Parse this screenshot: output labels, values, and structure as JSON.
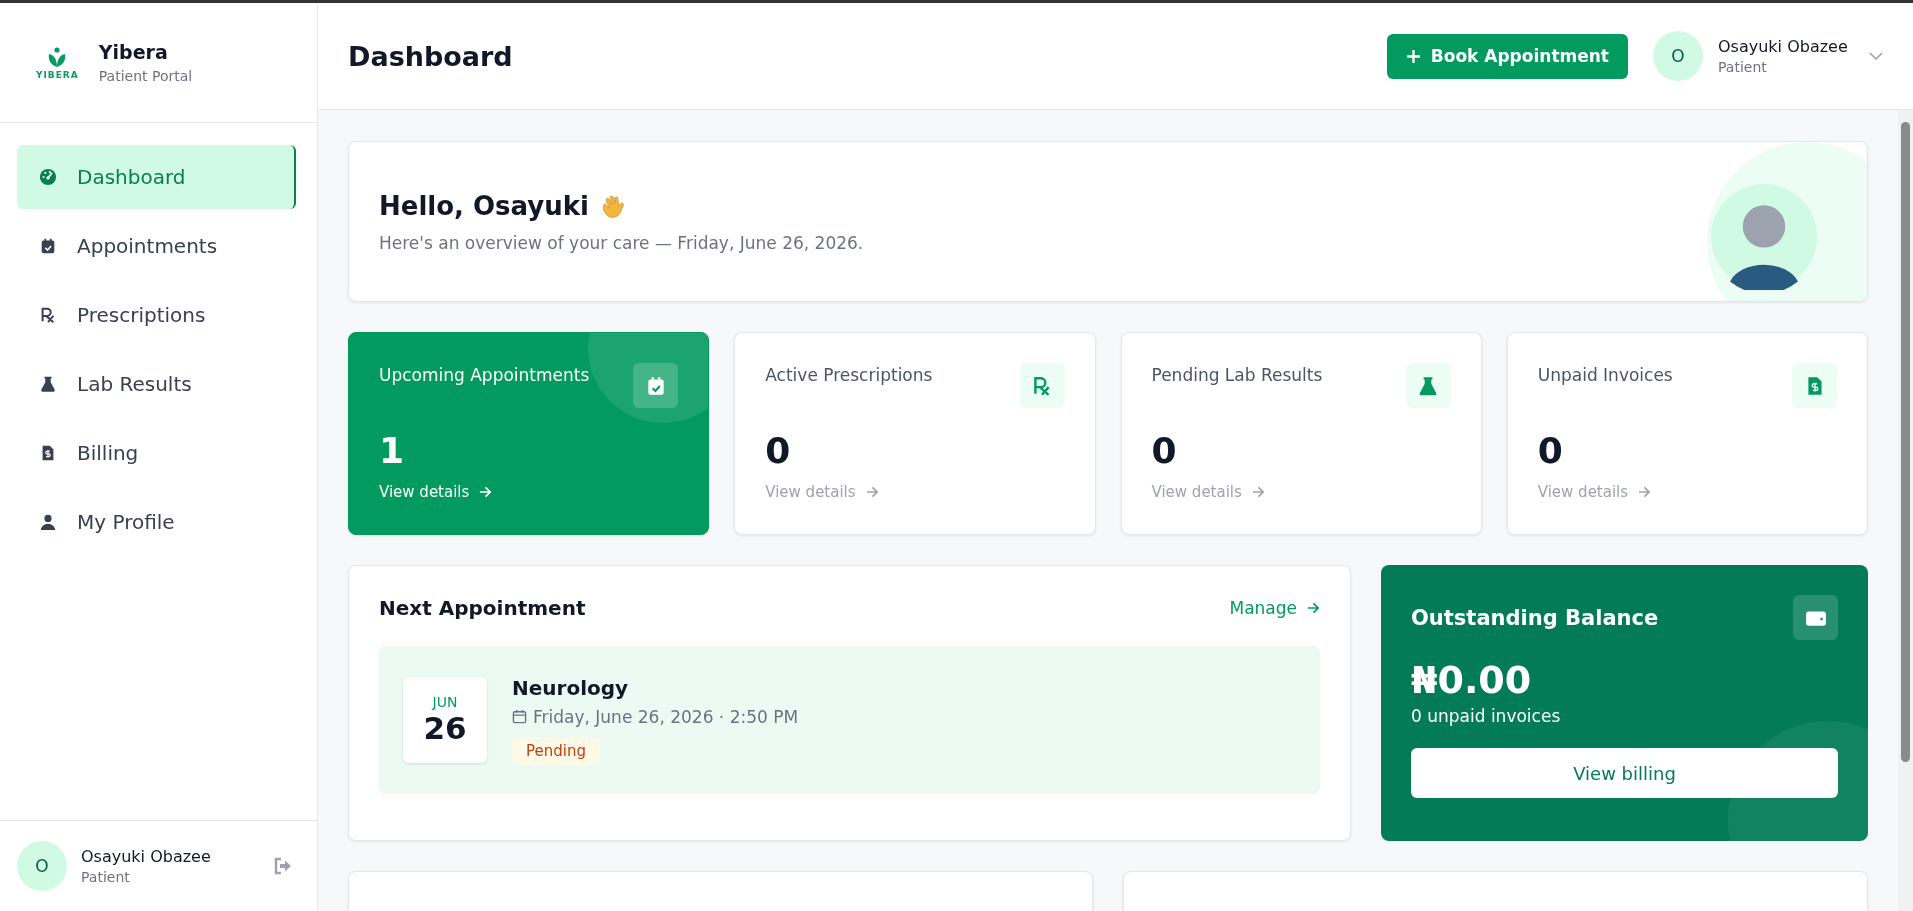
{
  "sidebar": {
    "brand": {
      "logo_text": "YIBERA",
      "name": "Yibera",
      "subtitle": "Patient Portal"
    },
    "items": [
      {
        "label": "Dashboard",
        "selected": true
      },
      {
        "label": "Appointments",
        "selected": false
      },
      {
        "label": "Prescriptions",
        "selected": false
      },
      {
        "label": "Lab Results",
        "selected": false
      },
      {
        "label": "Billing",
        "selected": false
      },
      {
        "label": "My Profile",
        "selected": false
      }
    ],
    "user": {
      "initial": "O",
      "name": "Osayuki Obazee",
      "role": "Patient"
    }
  },
  "header": {
    "title": "Dashboard",
    "book_button": "Book Appointment",
    "user": {
      "initial": "O",
      "name": "Osayuki Obazee",
      "role": "Patient"
    }
  },
  "greeting": {
    "title": "Hello, Osayuki",
    "subtitle": "Here's an overview of your care — Friday, June 26, 2026."
  },
  "stats": [
    {
      "label": "Upcoming Appointments",
      "value": "1",
      "link": "View details",
      "highlighted": true
    },
    {
      "label": "Active Prescriptions",
      "value": "0",
      "link": "View details",
      "highlighted": false
    },
    {
      "label": "Pending Lab Results",
      "value": "0",
      "link": "View details",
      "highlighted": false
    },
    {
      "label": "Unpaid Invoices",
      "value": "0",
      "link": "View details",
      "highlighted": false
    }
  ],
  "next_appointment": {
    "title": "Next Appointment",
    "link": "Manage",
    "month": "JUN",
    "day": "26",
    "specialty": "Neurology",
    "datetime": "Friday, June 26, 2026 · 2:50 PM",
    "status": "Pending"
  },
  "balance": {
    "title": "Outstanding Balance",
    "amount": "₦0.00",
    "note": "0 unpaid invoices",
    "button": "View billing"
  }
}
